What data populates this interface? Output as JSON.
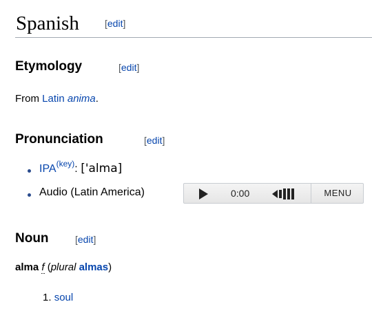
{
  "language_section": {
    "title": "Spanish",
    "edit_bracket_open": "[",
    "edit_label": "edit",
    "edit_bracket_close": "]"
  },
  "etymology": {
    "heading": "Etymology",
    "edit_label": "edit",
    "text_prefix": "From ",
    "lang_link": "Latin",
    "term": "anima",
    "text_suffix": "."
  },
  "pronunciation": {
    "heading": "Pronunciation",
    "edit_label": "edit",
    "ipa_link": "IPA",
    "key_link": "(key)",
    "ipa_colon": ":",
    "ipa_value": "['alma]",
    "audio_label": "Audio (Latin America)",
    "player": {
      "time": "0:00",
      "menu_label": "MENU",
      "play_icon": "play-icon",
      "volume_icon": "volume-icon"
    }
  },
  "noun": {
    "heading": "Noun",
    "edit_label": "edit",
    "headword": "alma",
    "gender": "f",
    "plural_prefix": "(",
    "plural_word": "plural",
    "plural_form": "almas",
    "plural_suffix": ")",
    "definitions": [
      {
        "number": "1.",
        "text": "soul"
      }
    ]
  },
  "colors": {
    "link": "#0645ad",
    "text": "#000000",
    "rule": "#a2a9b1"
  }
}
